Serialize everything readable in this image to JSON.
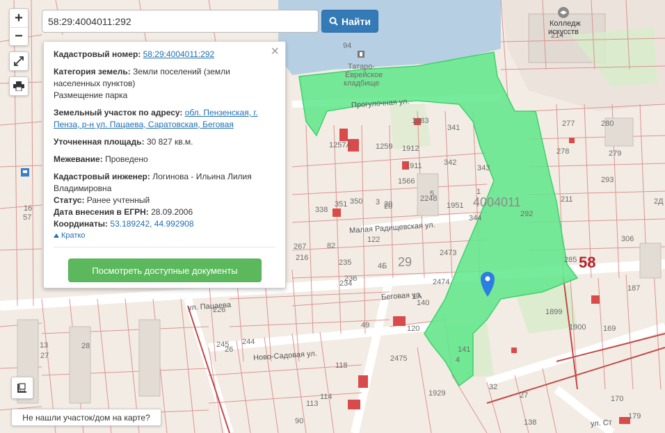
{
  "search": {
    "value": "58:29:4004011:292",
    "button_label": "Найти"
  },
  "controls": {
    "zoom_in": "+",
    "zoom_out": "−"
  },
  "popup": {
    "cadastral_label": "Кадастровый номер:",
    "cadastral_value": "58:29:4004011:292",
    "category_label": "Категория земель:",
    "category_value": "Земли поселений (земли населенных пунктов)",
    "usage": "Размещение парка",
    "address_label": "Земельный участок по адресу:",
    "address_value": "обл. Пензенская, г. Пенза, р-н ул. Пацаева, Саратовская, Беговая",
    "area_label": "Уточненная площадь:",
    "area_value": "30 827 кв.м.",
    "survey_label": "Межевание:",
    "survey_value": "Проведено",
    "engineer_label": "Кадастровый инженер:",
    "engineer_value": "Логинова - Ильина Лилия Владимировна",
    "status_label": "Статус:",
    "status_value": "Ранее учтенный",
    "date_label": "Дата внесения в ЕГРН:",
    "date_value": "28.09.2006",
    "coords_label": "Координаты:",
    "coords_value": "53.189242, 44.992908",
    "short_link": "Кратко",
    "docs_button": "Посмотреть доступные документы"
  },
  "not_found_button": "Не нашли участок/дом на карте?",
  "map_labels": [
    {
      "text": "94",
      "cls": ""
    },
    {
      "text": "Татаро-",
      "cls": ""
    },
    {
      "text": "Еврейское",
      "cls": ""
    },
    {
      "text": "кладбище",
      "cls": ""
    },
    {
      "text": "Прогулочная ул.",
      "cls": "street"
    },
    {
      "text": "Колледж",
      "cls": "dark"
    },
    {
      "text": "искусств",
      "cls": "dark"
    },
    {
      "text": "214",
      "cls": ""
    },
    {
      "text": "1283",
      "cls": ""
    },
    {
      "text": "341",
      "cls": ""
    },
    {
      "text": "1257А",
      "cls": ""
    },
    {
      "text": "1259",
      "cls": ""
    },
    {
      "text": "1912",
      "cls": ""
    },
    {
      "text": "1911",
      "cls": ""
    },
    {
      "text": "342",
      "cls": ""
    },
    {
      "text": "343",
      "cls": ""
    },
    {
      "text": "1566",
      "cls": ""
    },
    {
      "text": "5",
      "cls": ""
    },
    {
      "text": "2248",
      "cls": ""
    },
    {
      "text": "1951",
      "cls": ""
    },
    {
      "text": "1",
      "cls": ""
    },
    {
      "text": "4004011",
      "cls": "big"
    },
    {
      "text": "292",
      "cls": ""
    },
    {
      "text": "338",
      "cls": ""
    },
    {
      "text": "351",
      "cls": ""
    },
    {
      "text": "350",
      "cls": ""
    },
    {
      "text": "3",
      "cls": ""
    },
    {
      "text": "20",
      "cls": ""
    },
    {
      "text": "344",
      "cls": ""
    },
    {
      "text": "Малая Радищевская ул.",
      "cls": "street"
    },
    {
      "text": "122",
      "cls": ""
    },
    {
      "text": "82",
      "cls": ""
    },
    {
      "text": "267",
      "cls": ""
    },
    {
      "text": "216",
      "cls": ""
    },
    {
      "text": "29",
      "cls": "big"
    },
    {
      "text": "2473",
      "cls": ""
    },
    {
      "text": "4Б",
      "cls": ""
    },
    {
      "text": "236",
      "cls": ""
    },
    {
      "text": "235",
      "cls": ""
    },
    {
      "text": "234",
      "cls": ""
    },
    {
      "text": "2474",
      "cls": ""
    },
    {
      "text": "1А",
      "cls": ""
    },
    {
      "text": "140",
      "cls": ""
    },
    {
      "text": "Беговая ул.",
      "cls": "street"
    },
    {
      "text": "49",
      "cls": ""
    },
    {
      "text": "120",
      "cls": ""
    },
    {
      "text": "2475",
      "cls": ""
    },
    {
      "text": "141",
      "cls": ""
    },
    {
      "text": "4",
      "cls": ""
    },
    {
      "text": "Ново-Садовая ул.",
      "cls": "street"
    },
    {
      "text": "ул. Пацаева",
      "cls": "street"
    },
    {
      "text": "226",
      "cls": ""
    },
    {
      "text": "245",
      "cls": ""
    },
    {
      "text": "26",
      "cls": ""
    },
    {
      "text": "244",
      "cls": ""
    },
    {
      "text": "13",
      "cls": ""
    },
    {
      "text": "28",
      "cls": ""
    },
    {
      "text": "27",
      "cls": ""
    },
    {
      "text": "16",
      "cls": ""
    },
    {
      "text": "57",
      "cls": ""
    },
    {
      "text": "118",
      "cls": ""
    },
    {
      "text": "114",
      "cls": ""
    },
    {
      "text": "113",
      "cls": ""
    },
    {
      "text": "90",
      "cls": ""
    },
    {
      "text": "1929",
      "cls": ""
    },
    {
      "text": "32",
      "cls": ""
    },
    {
      "text": "27",
      "cls": ""
    },
    {
      "text": "138",
      "cls": ""
    },
    {
      "text": "277",
      "cls": ""
    },
    {
      "text": "280",
      "cls": ""
    },
    {
      "text": "278",
      "cls": ""
    },
    {
      "text": "279",
      "cls": ""
    },
    {
      "text": "293",
      "cls": ""
    },
    {
      "text": "211",
      "cls": ""
    },
    {
      "text": "306",
      "cls": ""
    },
    {
      "text": "58",
      "cls": "red"
    },
    {
      "text": "285",
      "cls": ""
    },
    {
      "text": "187",
      "cls": ""
    },
    {
      "text": "1899",
      "cls": ""
    },
    {
      "text": "1900",
      "cls": ""
    },
    {
      "text": "169",
      "cls": ""
    },
    {
      "text": "170",
      "cls": ""
    },
    {
      "text": "179",
      "cls": ""
    },
    {
      "text": "ул. Ст",
      "cls": "street"
    },
    {
      "text": "2Д",
      "cls": ""
    },
    {
      "text": "20",
      "cls": ""
    }
  ],
  "colors": {
    "parcel_fill": "#5ee88a",
    "parcel_stroke": "#3fcf6e",
    "boundary": "#d98a86",
    "marker": "#2b7de0",
    "accent_button": "#337ab7",
    "docs_button": "#5cb85c",
    "river": "#a8c6df"
  }
}
